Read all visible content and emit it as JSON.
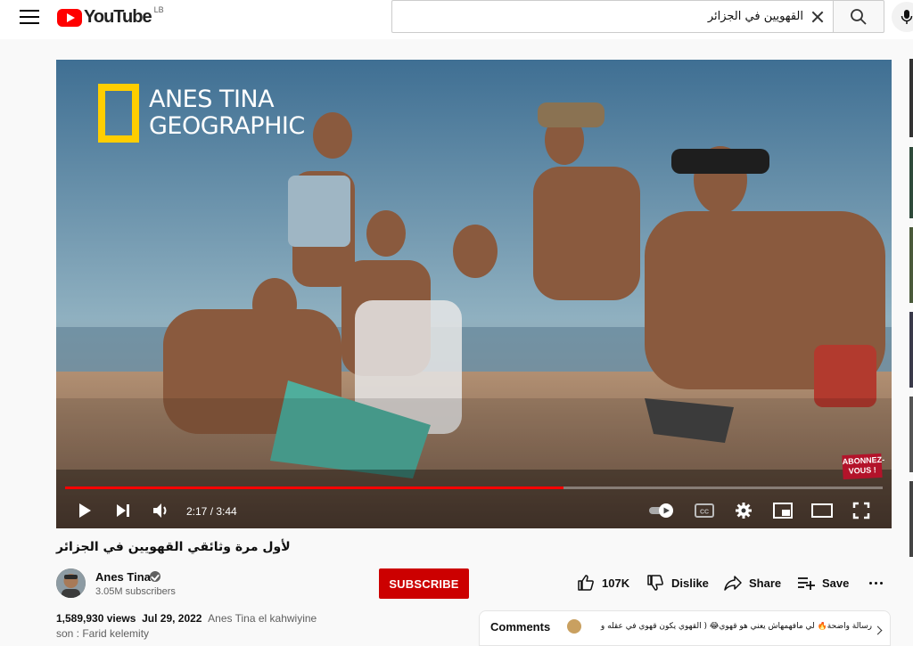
{
  "header": {
    "logo_text": "YouTube",
    "country_code": "LB",
    "search_query": "القهويين في الجزائر"
  },
  "player": {
    "overlay_title_line1": "ANES TINA",
    "overlay_title_line2": "GEOGRAPHIC",
    "watermark_text": "ABONNEZ-VOUS !",
    "current_time": "2:17",
    "duration": "3:44",
    "time_display": "2:17 / 3:44",
    "progress_fraction": 0.61
  },
  "video": {
    "title": "لأول مرة وثائقي القهويين في الجزائر",
    "views": "1,589,930 views",
    "date": "Jul 29, 2022",
    "tags_text": "Anes Tina el kahwiyine",
    "desc_line2": "son : Farid kelemity"
  },
  "channel": {
    "name": "Anes Tina",
    "subscribers": "3.05M subscribers",
    "subscribe_label": "SUBSCRIBE"
  },
  "actions": {
    "like_count": "107K",
    "dislike_label": "Dislike",
    "share_label": "Share",
    "save_label": "Save"
  },
  "comments": {
    "label": "Comments",
    "preview_text": "رسالة واضحة🔥 لي مافهمهاش يعني هو قهوي😂 ( القهوي يكون قهوي في عقله و"
  },
  "colors": {
    "brand_red": "#ff0000",
    "subscribe_red": "#cc0000",
    "ng_yellow": "#ffce00"
  }
}
